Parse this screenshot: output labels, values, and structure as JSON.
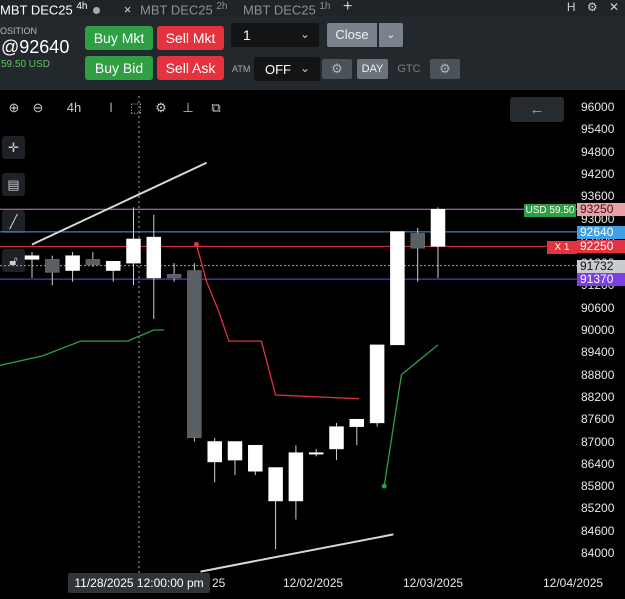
{
  "tabs": [
    {
      "label": "MBT DEC25",
      "sup": "4h",
      "active": true
    },
    {
      "label": "MBT DEC25",
      "sup": "2h",
      "active": false
    },
    {
      "label": "MBT DEC25",
      "sup": "1h",
      "active": false
    }
  ],
  "tab_add": "+",
  "tab_close": "×",
  "top_icons": {
    "h": "H",
    "gear": "⚙",
    "close": "✕"
  },
  "position": {
    "label": "OSITION",
    "price": "@92640",
    "pnl": "59.50 USD"
  },
  "buttons": {
    "buy_mkt": "Buy Mkt",
    "sell_mkt": "Sell Mkt",
    "buy_bid": "Buy Bid",
    "sell_ask": "Sell Ask",
    "close": "Close"
  },
  "quantity": "1",
  "atm_label": "ATM",
  "atm_value": "OFF",
  "tif": {
    "day": "DAY",
    "gtc": "GTC"
  },
  "colors": {
    "buy": "#2ea043",
    "sell": "#e5323f",
    "position_line": "#3fa0e8",
    "order_line": "#e5323f",
    "profit_line": "#c87fd0"
  },
  "chart_data": {
    "type": "candlestick",
    "timeframe": "4h",
    "ylim": [
      83500,
      96300
    ],
    "y_ticks": [
      96000,
      95400,
      94800,
      94200,
      93600,
      93000,
      92400,
      91800,
      91200,
      90600,
      90000,
      89400,
      88800,
      88200,
      87600,
      87000,
      86400,
      85800,
      85200,
      84600,
      84000
    ],
    "x_labels": [
      "25",
      "12/02/2025",
      "12/03/2025",
      "12/04/2025"
    ],
    "crosshair_date": "11/28/2025 12:00:00 pm",
    "candles": [
      {
        "o": 91900,
        "h": 92100,
        "l": 91400,
        "c": 92000
      },
      {
        "o": 91900,
        "h": 92000,
        "l": 91200,
        "c": 91550
      },
      {
        "o": 91600,
        "h": 92100,
        "l": 91300,
        "c": 92000
      },
      {
        "o": 91900,
        "h": 92100,
        "l": 91700,
        "c": 91750
      },
      {
        "o": 91600,
        "h": 91700,
        "l": 91300,
        "c": 91850
      },
      {
        "o": 91800,
        "h": 93300,
        "l": 91200,
        "c": 92450
      },
      {
        "o": 91400,
        "h": 93100,
        "l": 90300,
        "c": 92500
      },
      {
        "o": 91500,
        "h": 91800,
        "l": 91300,
        "c": 91400
      },
      {
        "o": 91600,
        "h": 91800,
        "l": 87000,
        "c": 87100
      },
      {
        "o": 86450,
        "h": 87100,
        "l": 85900,
        "c": 87000
      },
      {
        "o": 86500,
        "h": 87000,
        "l": 86100,
        "c": 87000
      },
      {
        "o": 86200,
        "h": 86900,
        "l": 86100,
        "c": 86900
      },
      {
        "o": 85400,
        "h": 86200,
        "l": 84100,
        "c": 86300
      },
      {
        "o": 85400,
        "h": 86900,
        "l": 84900,
        "c": 86700
      },
      {
        "o": 86700,
        "h": 86800,
        "l": 86600,
        "c": 86700
      },
      {
        "o": 86800,
        "h": 87500,
        "l": 86500,
        "c": 87400
      },
      {
        "o": 87400,
        "h": 87600,
        "l": 86900,
        "c": 87600
      },
      {
        "o": 87500,
        "h": 89600,
        "l": 87400,
        "c": 89600
      },
      {
        "o": 89600,
        "h": 92500,
        "l": 89600,
        "c": 92650
      },
      {
        "o": 92600,
        "h": 92750,
        "l": 91300,
        "c": 92200
      },
      {
        "o": 92250,
        "h": 93300,
        "l": 91400,
        "c": 93250
      }
    ],
    "green_line": [
      [
        0,
        89000
      ],
      [
        5,
        89700
      ],
      [
        6,
        90000
      ],
      [
        7,
        90000
      ]
    ],
    "green_line2": [
      [
        17.35,
        85800
      ],
      [
        18.2,
        88800
      ],
      [
        20,
        89600
      ]
    ],
    "red_line": [
      [
        8.1,
        92300
      ],
      [
        9.7,
        89700
      ],
      [
        12,
        88200
      ],
      [
        16.1,
        88100
      ]
    ],
    "trend_upper": [
      [
        0,
        92300
      ],
      [
        8.6,
        94500
      ]
    ],
    "trend_lower": [
      [
        8.3,
        83500
      ],
      [
        17.8,
        84500
      ]
    ],
    "price_levels": [
      {
        "name": "profit",
        "label": "USD 59.50",
        "value": 93250,
        "color": "#c87fd0"
      },
      {
        "name": "position",
        "value": 92640,
        "color": "#3fa0e8"
      },
      {
        "name": "order",
        "label": "X 1",
        "value": 92250,
        "color": "#e5323f"
      },
      {
        "name": "last",
        "value": 91732,
        "color": "#9aa0a6"
      },
      {
        "name": "low",
        "value": 91370,
        "color": "#7b3fe4"
      }
    ],
    "axis_tags": [
      {
        "text": "93250",
        "bg": "#e9a0a6",
        "fg": "#3a1a1c"
      },
      {
        "text": "92640",
        "bg": "#3fa0e8",
        "fg": "#ffffff"
      },
      {
        "text": "92250",
        "bg": "#e5323f",
        "fg": "#ffffff"
      },
      {
        "text": "91732",
        "bg": "#c8ccd0",
        "fg": "#111111"
      },
      {
        "text": "91370",
        "bg": "#7b3fe4",
        "fg": "#ffffff"
      }
    ]
  }
}
